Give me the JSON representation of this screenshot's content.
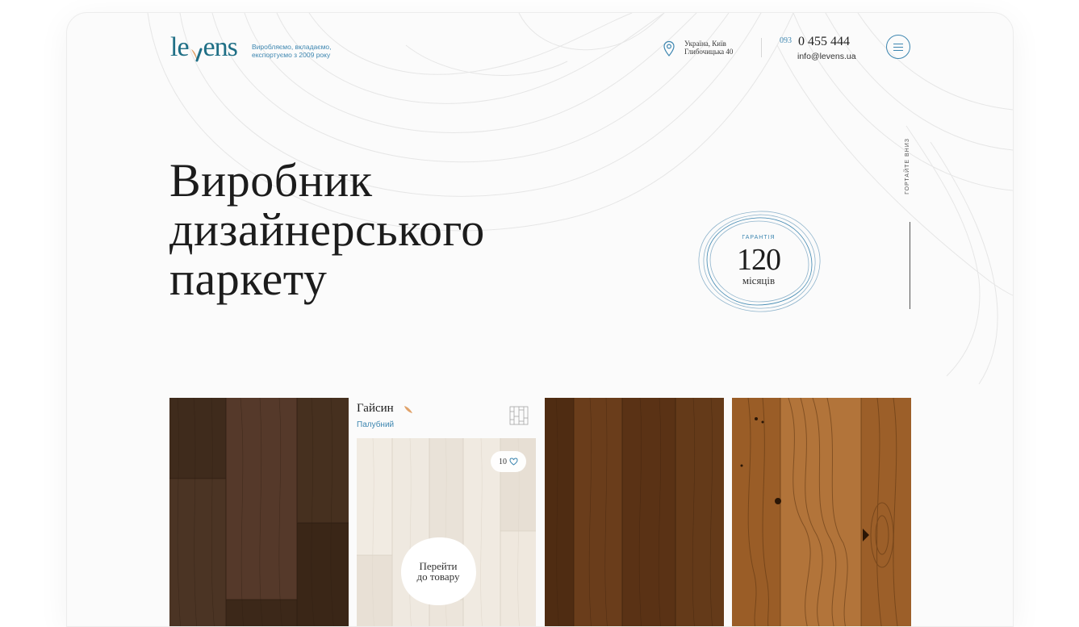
{
  "header": {
    "logo": {
      "left": "le",
      "right": "ens"
    },
    "tagline_line1": "Виробляємо, вкладаємо,",
    "tagline_line2": "експортуємо з 2009 року",
    "location_line1": "Україна, Київ",
    "location_line2": "Глибочицька 40",
    "phone_code": "093",
    "phone_number": "0 455 444",
    "email": "info@levens.ua"
  },
  "hero": {
    "title_line1": "Виробник",
    "title_line2": "дизайнерського",
    "title_line3": "паркету"
  },
  "badge": {
    "label": "ГАРАНТІЯ",
    "value": "120",
    "unit": "місяців"
  },
  "scroll_hint": "ГОРТАЙТЕ ВНИЗ",
  "products": {
    "featured": {
      "name": "Гайсин",
      "type": "Палубний",
      "likes": "10",
      "cta_line1": "Перейти",
      "cta_line2": "до товару"
    }
  },
  "colors": {
    "accent": "#3d86b0",
    "logo": "#1f6f86",
    "leaf": "#e0a26a",
    "background": "#fbfbfb"
  },
  "icons": [
    "location-pin-icon",
    "menu-icon",
    "leaf-icon",
    "pattern-icon",
    "heart-icon"
  ]
}
